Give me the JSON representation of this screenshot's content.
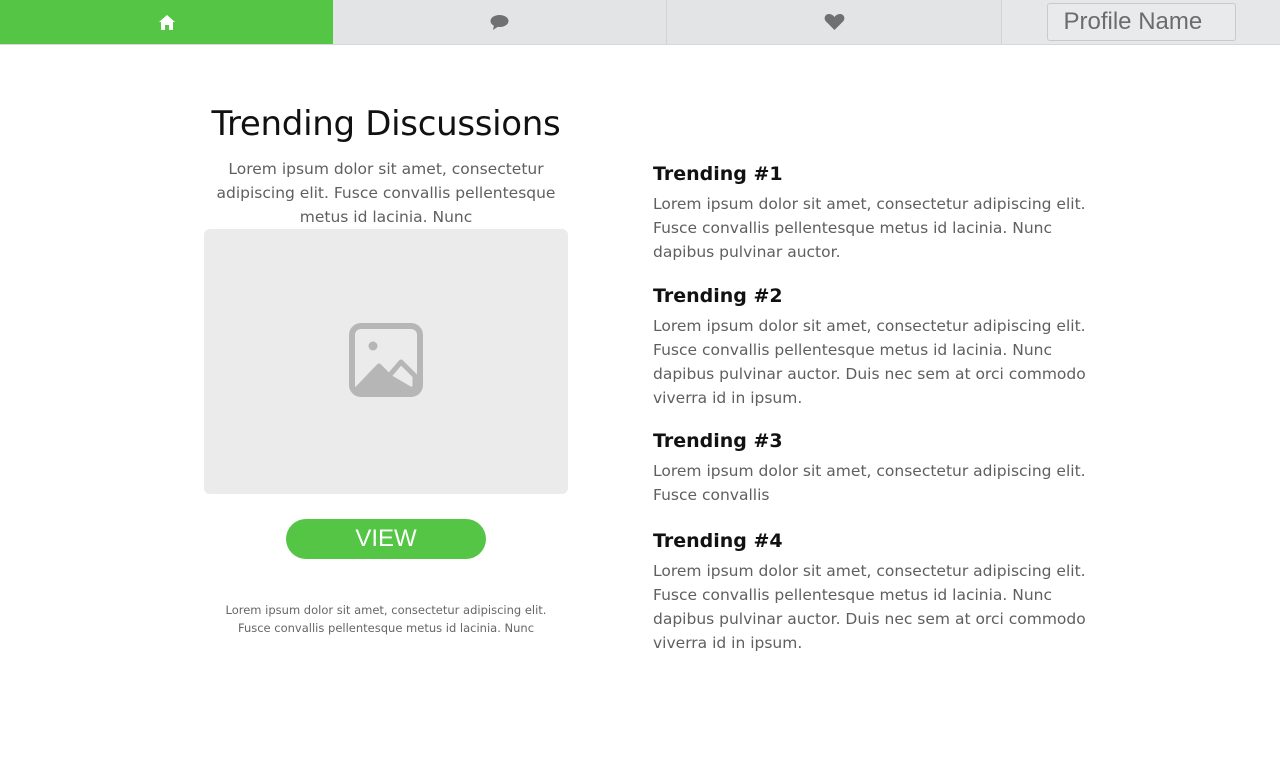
{
  "nav": {
    "tabs": [
      {
        "icon": "home-icon",
        "active": true
      },
      {
        "icon": "chat-bubble-icon",
        "active": false
      },
      {
        "icon": "heart-icon",
        "active": false
      }
    ],
    "profile_name": "Profile Name",
    "accent_color": "#54c544"
  },
  "main": {
    "title": "Trending Discussions",
    "intro": "Lorem ipsum dolor sit amet, consectetur adipiscing elit. Fusce convallis pellentesque metus id lacinia. Nunc",
    "image_icon": "image-icon",
    "view_button": "VIEW",
    "caption": "Lorem ipsum dolor sit amet, consectetur adipiscing elit. Fusce convallis pellentesque metus id lacinia. Nunc"
  },
  "trending": [
    {
      "title": "Trending #1",
      "text": "Lorem ipsum dolor sit amet, consectetur adipiscing elit. Fusce convallis pellentesque metus id lacinia. Nunc dapibus pulvinar auctor."
    },
    {
      "title": "Trending #2",
      "text": "Lorem ipsum dolor sit amet, consectetur adipiscing elit. Fusce convallis pellentesque metus id lacinia. Nunc dapibus pulvinar auctor. Duis nec sem at orci commodo viverra id in ipsum."
    },
    {
      "title": "Trending #3",
      "text": "Lorem ipsum dolor sit amet, consectetur adipiscing elit. Fusce convallis"
    },
    {
      "title": "Trending #4",
      "text": "Lorem ipsum dolor sit amet, consectetur adipiscing elit. Fusce convallis pellentesque metus id lacinia. Nunc dapibus pulvinar auctor. Duis nec sem at orci commodo viverra id in ipsum."
    }
  ]
}
